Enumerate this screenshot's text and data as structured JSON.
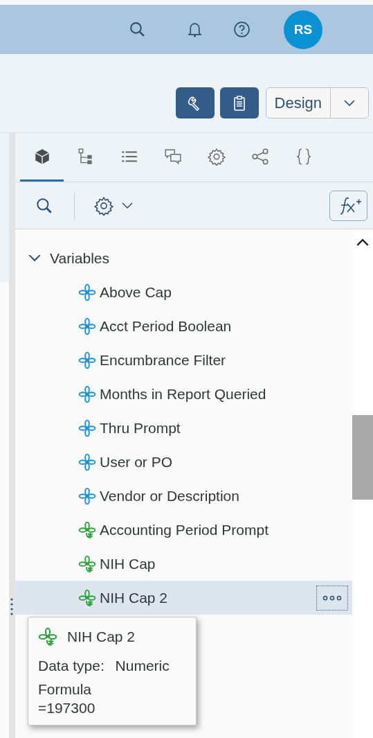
{
  "header": {
    "avatar": "RS"
  },
  "toolbar": {
    "mode_button": "Design"
  },
  "tabs": [
    {
      "kind": "cube",
      "selected": true
    },
    {
      "kind": "hierarchy",
      "selected": false
    },
    {
      "kind": "list",
      "selected": false
    },
    {
      "kind": "comments",
      "selected": false
    },
    {
      "kind": "gear",
      "selected": false
    },
    {
      "kind": "share",
      "selected": false
    },
    {
      "kind": "braces",
      "selected": false
    }
  ],
  "tree": {
    "group": {
      "label": "Variables",
      "expanded": true,
      "children": [
        {
          "label": "Above Cap",
          "kind": "dimension",
          "selected": false
        },
        {
          "label": "Acct Period Boolean",
          "kind": "dimension",
          "selected": false
        },
        {
          "label": "Encumbrance Filter",
          "kind": "dimension",
          "selected": false
        },
        {
          "label": "Months in Report Queried",
          "kind": "dimension",
          "selected": false
        },
        {
          "label": "Thru Prompt",
          "kind": "dimension",
          "selected": false
        },
        {
          "label": "User or PO",
          "kind": "dimension",
          "selected": false
        },
        {
          "label": "Vendor or Description",
          "kind": "dimension",
          "selected": false
        },
        {
          "label": "Accounting Period Prompt",
          "kind": "measure",
          "selected": false
        },
        {
          "label": "NIH Cap",
          "kind": "measure",
          "selected": false
        },
        {
          "label": "NIH Cap 2",
          "kind": "measure",
          "selected": true
        }
      ]
    }
  },
  "tooltip": {
    "title": "NIH Cap 2",
    "kind": "measure",
    "data_type_label": "Data type:",
    "data_type": "Numeric",
    "formula_label": "Formula",
    "formula": "=197300"
  }
}
